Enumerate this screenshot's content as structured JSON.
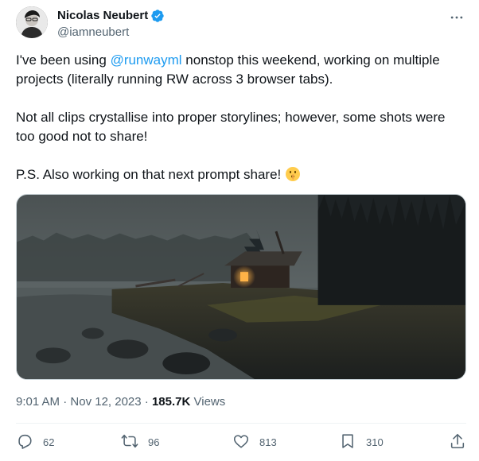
{
  "author": {
    "display_name": "Nicolas Neubert",
    "handle": "@iamneubert",
    "verified": true
  },
  "menu_icon": "more-horizontal-icon",
  "text": {
    "line1_prefix": "I've been using ",
    "mention": "@runwayml",
    "line1_suffix": " nonstop this weekend, working on multiple projects (literally running RW across 3 browser tabs).",
    "paragraph2": "Not all clips crystallise into proper storylines; however, some shots were too good not to share!",
    "paragraph3": "P.S. Also working on that next prompt share! ",
    "paragraph3_emoji": "shushing-face-emoji"
  },
  "media": {
    "description_icon": "cabin-in-misty-forest-image"
  },
  "meta": {
    "time": "9:01 AM",
    "separator": " · ",
    "date": "Nov 12, 2023",
    "views_count": "185.7K",
    "views_label": " Views"
  },
  "actions": {
    "reply": {
      "icon": "reply-icon",
      "count": "62"
    },
    "retweet": {
      "icon": "retweet-icon",
      "count": "96"
    },
    "like": {
      "icon": "heart-icon",
      "count": "813"
    },
    "bookmark": {
      "icon": "bookmark-icon",
      "count": "310"
    },
    "share": {
      "icon": "share-icon"
    }
  },
  "colors": {
    "accent": "#1d9bf0",
    "text": "#0f1419",
    "muted": "#536471"
  }
}
